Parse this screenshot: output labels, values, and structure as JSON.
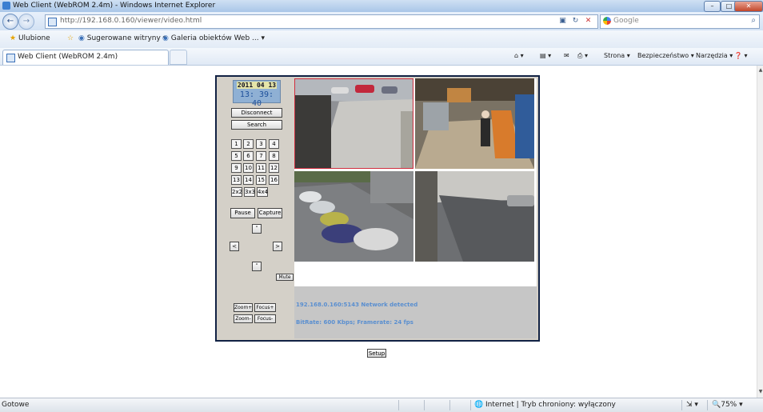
{
  "window": {
    "title": "Web Client (WebROM 2.4m) - Windows Internet Explorer",
    "minimize": "–",
    "maximize": "□",
    "close": "✕"
  },
  "address_bar": {
    "url": "http://192.168.0.160/viewer/video.html",
    "search_placeholder": "Google",
    "back_glyph": "←",
    "forward_glyph": "→",
    "icons": [
      "compat-view-icon",
      "refresh-icon",
      "stop-icon"
    ]
  },
  "favorites_bar": {
    "favorites_label": "Ulubione",
    "items": [
      "Sugerowane witryny ▾",
      "Galeria obiektów Web ... ▾"
    ]
  },
  "tab": {
    "title": "Web Client (WebROM 2.4m)"
  },
  "command_bar": {
    "page": "Strona ▾",
    "safety": "Bezpieczeństwo ▾",
    "tools": "Narzędzia ▾",
    "help": "❓ ▾"
  },
  "viewer": {
    "date": "2011 04 13",
    "time": "13: 39: 40",
    "disconnect_label": "Disconnect",
    "search_label": "Search",
    "channels": [
      "1",
      "2",
      "3",
      "4",
      "5",
      "6",
      "7",
      "8",
      "9",
      "10",
      "11",
      "12",
      "13",
      "14",
      "15",
      "16"
    ],
    "layouts": [
      "2x2",
      "3x3",
      "4x4"
    ],
    "pause_label": "Pause",
    "capture_label": "Capture",
    "ptz_up": "˄",
    "ptz_left": "<",
    "ptz_right": ">",
    "ptz_down": "˅",
    "mute_label": "Mute",
    "zoom_in_label": "Zoom+",
    "zoom_out_label": "Zoom-",
    "focus_in_label": "Focus+",
    "focus_out_label": "Focus-",
    "status_line1": "192.168.0.160:5143 Network detected",
    "status_line2": "BitRate: 600 Kbps; Framerate: 24 fps",
    "setup_label": "Setup"
  },
  "statusbar": {
    "left": "Gotowe",
    "zone": "Internet | Tryb chroniony: wyłączony",
    "zoom": "75%"
  }
}
